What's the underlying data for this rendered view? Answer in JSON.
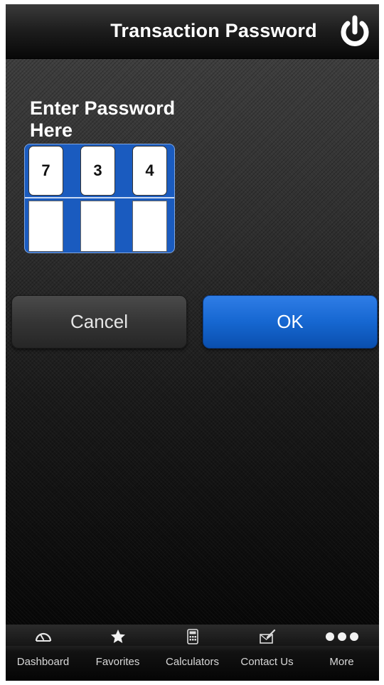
{
  "header": {
    "title": "Transaction Password",
    "power_icon": "power-icon"
  },
  "prompt": {
    "text": "Enter Password Here"
  },
  "password": {
    "digits": [
      "7",
      "3",
      "4"
    ],
    "bottom_cells": [
      "",
      "",
      ""
    ]
  },
  "buttons": {
    "cancel_label": "Cancel",
    "ok_label": "OK"
  },
  "tabbar": {
    "items": [
      {
        "label": "Dashboard",
        "icon": "speedometer-icon"
      },
      {
        "label": "Favorites",
        "icon": "star-icon"
      },
      {
        "label": "Calculators",
        "icon": "calculator-icon"
      },
      {
        "label": "Contact Us",
        "icon": "envelope-pencil-icon"
      },
      {
        "label": "More",
        "icon": "more-dots-icon"
      }
    ]
  },
  "colors": {
    "accent": "#1667d1",
    "pin_frame": "#1a5bbf",
    "background": "#0d0d0d"
  }
}
